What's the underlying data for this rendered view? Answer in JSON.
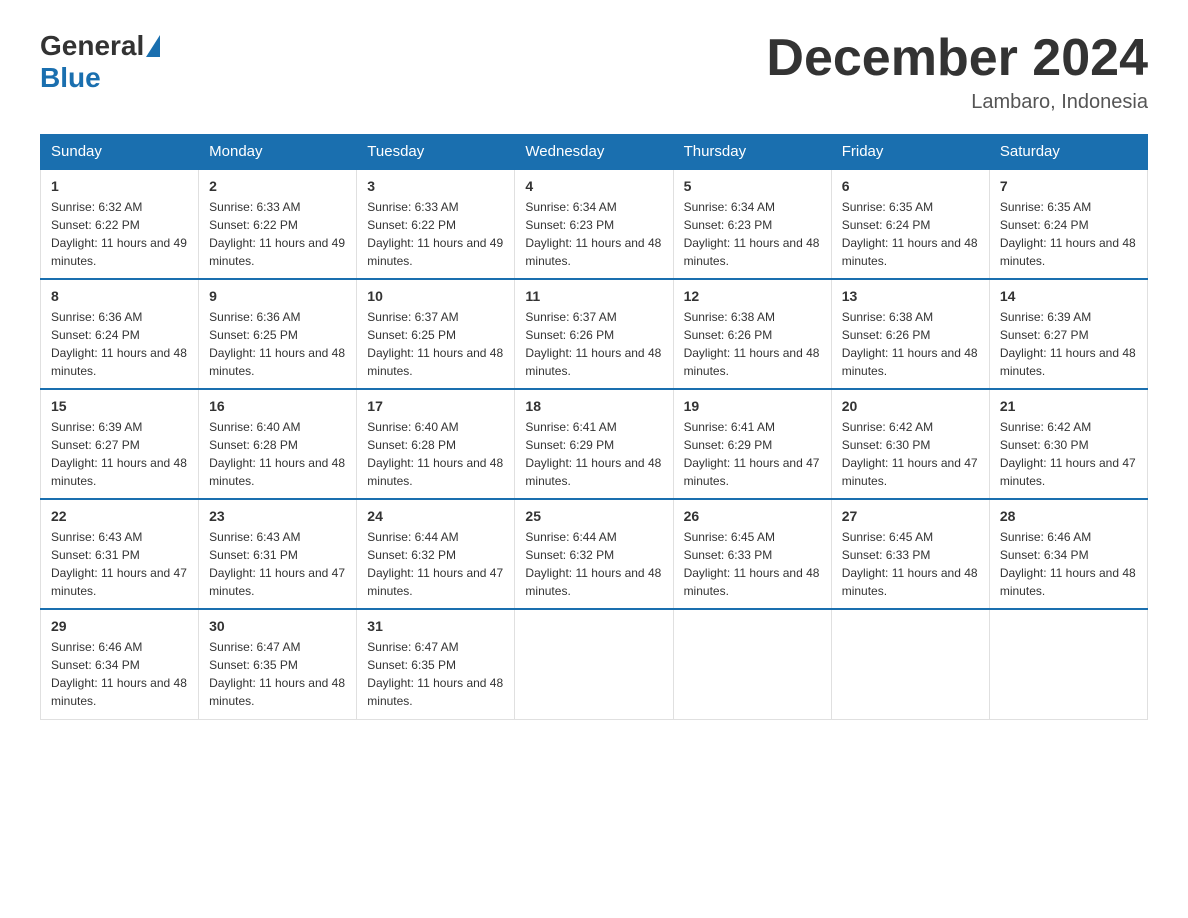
{
  "header": {
    "logo_general": "General",
    "logo_blue": "Blue",
    "month_title": "December 2024",
    "location": "Lambaro, Indonesia"
  },
  "weekdays": [
    "Sunday",
    "Monday",
    "Tuesday",
    "Wednesday",
    "Thursday",
    "Friday",
    "Saturday"
  ],
  "weeks": [
    [
      {
        "day": "1",
        "sunrise": "6:32 AM",
        "sunset": "6:22 PM",
        "daylight": "11 hours and 49 minutes."
      },
      {
        "day": "2",
        "sunrise": "6:33 AM",
        "sunset": "6:22 PM",
        "daylight": "11 hours and 49 minutes."
      },
      {
        "day": "3",
        "sunrise": "6:33 AM",
        "sunset": "6:22 PM",
        "daylight": "11 hours and 49 minutes."
      },
      {
        "day": "4",
        "sunrise": "6:34 AM",
        "sunset": "6:23 PM",
        "daylight": "11 hours and 48 minutes."
      },
      {
        "day": "5",
        "sunrise": "6:34 AM",
        "sunset": "6:23 PM",
        "daylight": "11 hours and 48 minutes."
      },
      {
        "day": "6",
        "sunrise": "6:35 AM",
        "sunset": "6:24 PM",
        "daylight": "11 hours and 48 minutes."
      },
      {
        "day": "7",
        "sunrise": "6:35 AM",
        "sunset": "6:24 PM",
        "daylight": "11 hours and 48 minutes."
      }
    ],
    [
      {
        "day": "8",
        "sunrise": "6:36 AM",
        "sunset": "6:24 PM",
        "daylight": "11 hours and 48 minutes."
      },
      {
        "day": "9",
        "sunrise": "6:36 AM",
        "sunset": "6:25 PM",
        "daylight": "11 hours and 48 minutes."
      },
      {
        "day": "10",
        "sunrise": "6:37 AM",
        "sunset": "6:25 PM",
        "daylight": "11 hours and 48 minutes."
      },
      {
        "day": "11",
        "sunrise": "6:37 AM",
        "sunset": "6:26 PM",
        "daylight": "11 hours and 48 minutes."
      },
      {
        "day": "12",
        "sunrise": "6:38 AM",
        "sunset": "6:26 PM",
        "daylight": "11 hours and 48 minutes."
      },
      {
        "day": "13",
        "sunrise": "6:38 AM",
        "sunset": "6:26 PM",
        "daylight": "11 hours and 48 minutes."
      },
      {
        "day": "14",
        "sunrise": "6:39 AM",
        "sunset": "6:27 PM",
        "daylight": "11 hours and 48 minutes."
      }
    ],
    [
      {
        "day": "15",
        "sunrise": "6:39 AM",
        "sunset": "6:27 PM",
        "daylight": "11 hours and 48 minutes."
      },
      {
        "day": "16",
        "sunrise": "6:40 AM",
        "sunset": "6:28 PM",
        "daylight": "11 hours and 48 minutes."
      },
      {
        "day": "17",
        "sunrise": "6:40 AM",
        "sunset": "6:28 PM",
        "daylight": "11 hours and 48 minutes."
      },
      {
        "day": "18",
        "sunrise": "6:41 AM",
        "sunset": "6:29 PM",
        "daylight": "11 hours and 48 minutes."
      },
      {
        "day": "19",
        "sunrise": "6:41 AM",
        "sunset": "6:29 PM",
        "daylight": "11 hours and 47 minutes."
      },
      {
        "day": "20",
        "sunrise": "6:42 AM",
        "sunset": "6:30 PM",
        "daylight": "11 hours and 47 minutes."
      },
      {
        "day": "21",
        "sunrise": "6:42 AM",
        "sunset": "6:30 PM",
        "daylight": "11 hours and 47 minutes."
      }
    ],
    [
      {
        "day": "22",
        "sunrise": "6:43 AM",
        "sunset": "6:31 PM",
        "daylight": "11 hours and 47 minutes."
      },
      {
        "day": "23",
        "sunrise": "6:43 AM",
        "sunset": "6:31 PM",
        "daylight": "11 hours and 47 minutes."
      },
      {
        "day": "24",
        "sunrise": "6:44 AM",
        "sunset": "6:32 PM",
        "daylight": "11 hours and 47 minutes."
      },
      {
        "day": "25",
        "sunrise": "6:44 AM",
        "sunset": "6:32 PM",
        "daylight": "11 hours and 48 minutes."
      },
      {
        "day": "26",
        "sunrise": "6:45 AM",
        "sunset": "6:33 PM",
        "daylight": "11 hours and 48 minutes."
      },
      {
        "day": "27",
        "sunrise": "6:45 AM",
        "sunset": "6:33 PM",
        "daylight": "11 hours and 48 minutes."
      },
      {
        "day": "28",
        "sunrise": "6:46 AM",
        "sunset": "6:34 PM",
        "daylight": "11 hours and 48 minutes."
      }
    ],
    [
      {
        "day": "29",
        "sunrise": "6:46 AM",
        "sunset": "6:34 PM",
        "daylight": "11 hours and 48 minutes."
      },
      {
        "day": "30",
        "sunrise": "6:47 AM",
        "sunset": "6:35 PM",
        "daylight": "11 hours and 48 minutes."
      },
      {
        "day": "31",
        "sunrise": "6:47 AM",
        "sunset": "6:35 PM",
        "daylight": "11 hours and 48 minutes."
      },
      null,
      null,
      null,
      null
    ]
  ]
}
